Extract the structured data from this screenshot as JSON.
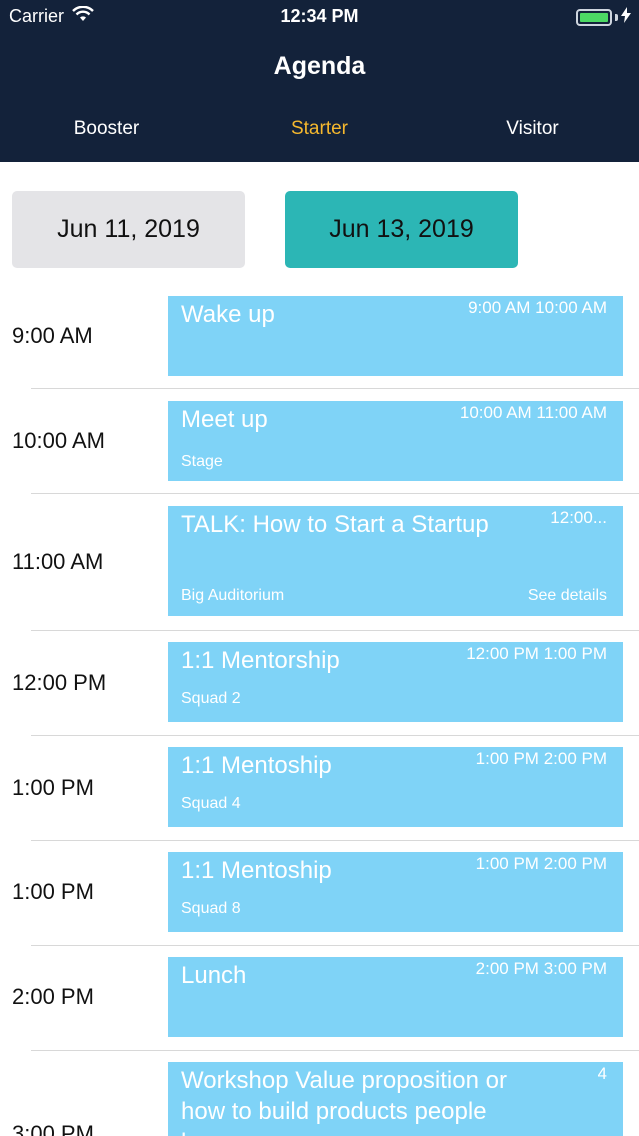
{
  "status_bar": {
    "carrier": "Carrier",
    "time": "12:34 PM",
    "battery_level": 1.0
  },
  "header": {
    "title": "Agenda",
    "tabs": [
      {
        "label": "Booster",
        "active": false
      },
      {
        "label": "Starter",
        "active": true
      },
      {
        "label": "Visitor",
        "active": false
      }
    ]
  },
  "dates": [
    {
      "label": "Jun 11, 2019",
      "selected": false
    },
    {
      "label": "Jun 13, 2019",
      "selected": true
    }
  ],
  "events": [
    {
      "time": "9:00 AM",
      "title": "Wake up",
      "range": "9:00 AM 10:00 AM",
      "location": "",
      "details": ""
    },
    {
      "time": "10:00 AM",
      "title": "Meet up",
      "range": "10:00 AM 11:00 AM",
      "location": "Stage",
      "details": ""
    },
    {
      "time": "11:00 AM",
      "title": "TALK: How to Start a Startup",
      "range": "12:00...",
      "location": "Big Auditorium",
      "details": "See details"
    },
    {
      "time": "12:00 PM",
      "title": "1:1 Mentorship",
      "range": "12:00 PM 1:00 PM",
      "location": "Squad 2",
      "details": ""
    },
    {
      "time": "1:00 PM",
      "title": "1:1 Mentoship",
      "range": "1:00 PM 2:00 PM",
      "location": "Squad 4",
      "details": ""
    },
    {
      "time": "1:00 PM",
      "title": "1:1 Mentoship",
      "range": "1:00 PM 2:00 PM",
      "location": "Squad 8",
      "details": ""
    },
    {
      "time": "2:00 PM",
      "title": "Lunch",
      "range": "2:00 PM 3:00 PM",
      "location": "",
      "details": ""
    },
    {
      "time": "3:00 PM",
      "title": "Workshop Value proposition or how to build products people love",
      "range": "4",
      "location": "",
      "details": ""
    }
  ],
  "colors": {
    "header_bg": "#13223a",
    "active_tab": "#f5b82e",
    "selected_date": "#2cb6b5",
    "unselected_date": "#e4e4e7",
    "card_bg": "#7fd3f7"
  }
}
